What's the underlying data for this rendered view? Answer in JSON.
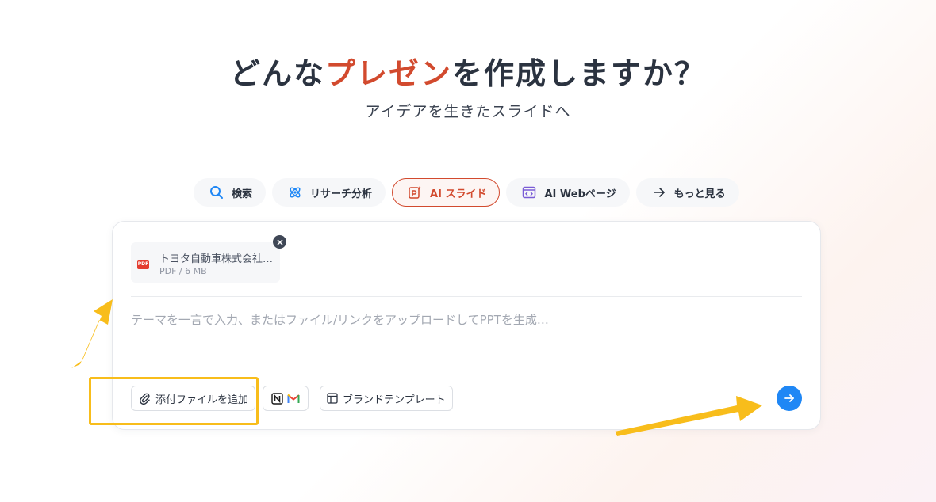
{
  "hero": {
    "title_before": "どんな",
    "title_accent": "プレゼン",
    "title_after": "を作成しますか？",
    "subtitle": "アイデアを生きたスライドへ"
  },
  "tabs": [
    {
      "label": "検索",
      "icon": "search-icon"
    },
    {
      "label": "リサーチ分析",
      "icon": "atom-icon"
    },
    {
      "label": "AI スライド",
      "icon": "slide-sparkle-icon",
      "active": true
    },
    {
      "label": "AI Webページ",
      "icon": "code-page-icon"
    },
    {
      "label": "もっと見る",
      "icon": "arrow-right-icon"
    }
  ],
  "attachment": {
    "file_type_badge": "PDF",
    "name": "トヨタ自動車株式会社",
    "meta": "PDF / 6 MB"
  },
  "prompt": {
    "placeholder": "テーマを一言で入力、またはファイル/リンクをアップロードしてPPTを生成…"
  },
  "toolbar": {
    "attach_label": "添付ファイルを追加",
    "brand_template_label": "ブランドテンプレート"
  },
  "colors": {
    "accent": "#d24a2e",
    "send_button": "#1f87f5",
    "annotation": "#f8bd1b"
  }
}
